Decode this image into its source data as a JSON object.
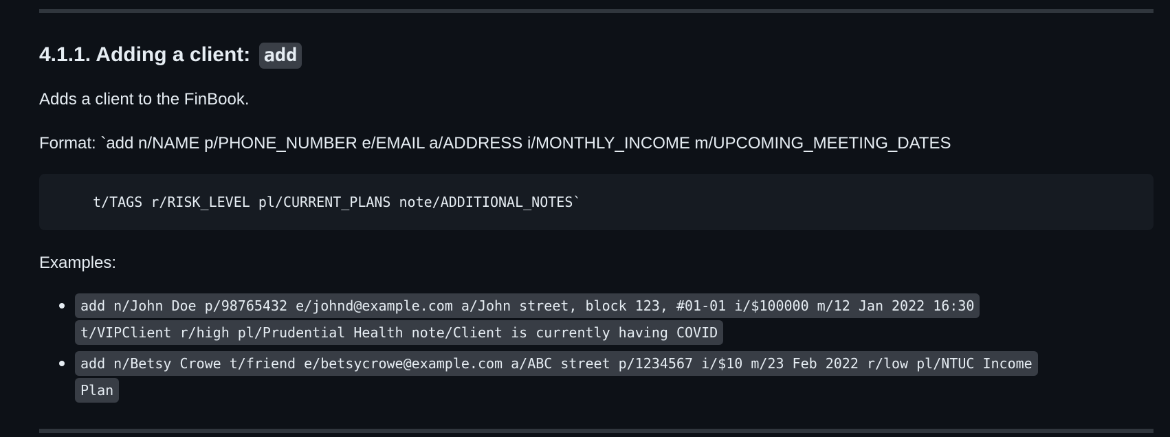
{
  "section": {
    "heading_text": "4.1.1. Adding a client:",
    "heading_code": "add",
    "description": "Adds a client to the FinBook.",
    "format_line": "Format: `add n/NAME p/PHONE_NUMBER e/EMAIL a/ADDRESS i/MONTHLY_INCOME m/UPCOMING_MEETING_DATES",
    "format_code_block": "t/TAGS r/RISK_LEVEL pl/CURRENT_PLANS note/ADDITIONAL_NOTES`",
    "examples_label": "Examples:",
    "examples": [
      {
        "line1": "add n/John Doe p/98765432 e/johnd@example.com a/John street, block 123, #01-01 i/$100000 m/12 Jan 2022 16:30",
        "line2": "t/VIPClient r/high pl/Prudential Health note/Client is currently having COVID"
      },
      {
        "line1": "add n/Betsy Crowe t/friend e/betsycrowe@example.com a/ABC street p/1234567 i/$10 m/23 Feb 2022 r/low pl/NTUC Income",
        "line2": "Plan"
      }
    ]
  },
  "colors": {
    "background": "#0d1117",
    "text": "#e6edf3",
    "rule": "#30363d",
    "code_block_bg": "#161b22",
    "inline_code_bg": "#383d45"
  }
}
